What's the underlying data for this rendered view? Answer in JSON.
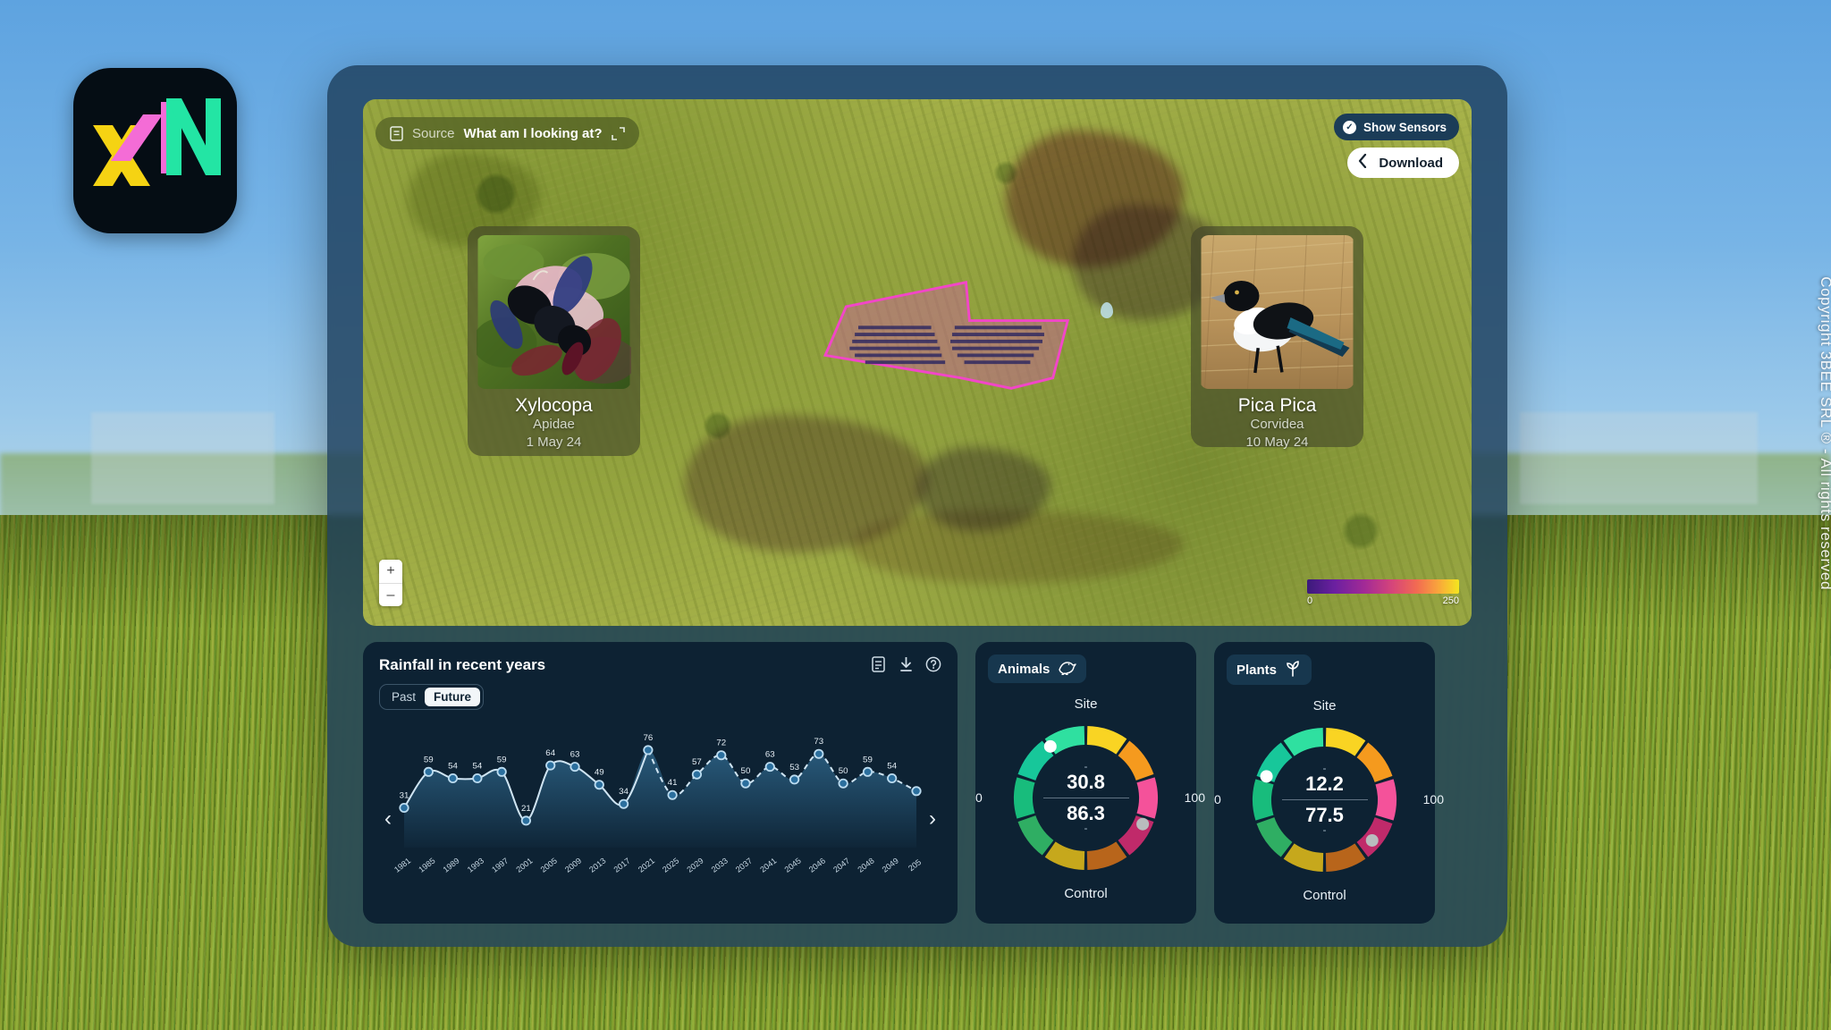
{
  "brand": {
    "logo_name": "xn-logo",
    "logo_colors": {
      "x": "#F5D313",
      "slash": "#F46CD6",
      "n": "#23E5A4",
      "bg": "#050d14"
    }
  },
  "copyright": "Copyright 3BEE SRL ® - All rights reserved",
  "map": {
    "source": {
      "icon": "document-icon",
      "label": "Source",
      "question": "What am I looking at?",
      "expand_icon": "expand-icon"
    },
    "actions": {
      "show_sensors": {
        "label": "Show Sensors",
        "icon": "check-circle-icon"
      },
      "download": {
        "label": "Download",
        "icon": "chevron-left-icon"
      }
    },
    "zoom": {
      "in_label": "+",
      "out_label": "–"
    },
    "legend": {
      "min": "0",
      "max": "250",
      "colors": [
        "#3b1a7a",
        "#a32a96",
        "#f26a52",
        "#f4e61f"
      ]
    },
    "parcel_color": "#F246C8",
    "species": [
      {
        "photo": "carpenter-bee-on-flower",
        "name": "Xylocopa",
        "family": "Apidae",
        "date": "1 May 24"
      },
      {
        "photo": "magpie-on-dry-grass",
        "name": "Pica Pica",
        "family": "Corvidea",
        "date": "10 May 24"
      }
    ]
  },
  "chart_panel": {
    "title": "Rainfall in recent years",
    "tools": [
      {
        "name": "notes-icon",
        "glyph": "note"
      },
      {
        "name": "download-icon",
        "glyph": "download"
      },
      {
        "name": "help-icon",
        "glyph": "help"
      }
    ],
    "segments": [
      {
        "label": "Past",
        "active": false
      },
      {
        "label": "Future",
        "active": true
      }
    ],
    "prev_label": "‹",
    "next_label": "›"
  },
  "chart_data": {
    "type": "line",
    "title": "Rainfall in recent years",
    "xlabel": "",
    "ylabel": "",
    "ylim": [
      0,
      85
    ],
    "grid": false,
    "legend": "none",
    "accent_color": "#4a9fd4",
    "categories": [
      "1981",
      "1985",
      "1989",
      "1993",
      "1997",
      "2001",
      "2005",
      "2009",
      "2013",
      "2017",
      "2021",
      "2025",
      "2029",
      "2033",
      "2037",
      "2041",
      "2045",
      "2046",
      "2047",
      "2048",
      "2049",
      "205"
    ],
    "x_tick_last_clipped": "205",
    "series": [
      {
        "name": "Rainfall",
        "values": [
          31,
          59,
          54,
          54,
          59,
          21,
          64,
          63,
          49,
          34,
          76,
          41,
          57,
          72,
          50,
          63,
          53,
          73,
          50,
          59,
          54,
          44
        ],
        "solid_until_index": 10,
        "style_past": "solid",
        "style_future": "dashed"
      }
    ],
    "point_labels": [
      "31",
      "59",
      "54",
      "54",
      "59",
      "21",
      "64",
      "63",
      "49",
      "34",
      "76",
      "41",
      "57",
      "72",
      "50",
      "63",
      "53",
      "73",
      "50",
      "59",
      "54",
      ""
    ]
  },
  "gauges": [
    {
      "tag": "Animals",
      "icon": "bird-icon",
      "top_label": "Site",
      "bottom_label": "Control",
      "scale_min": "0",
      "scale_max": "100",
      "site_value": "30.8",
      "control_value": "86.3",
      "site_dash": "-",
      "control_dash": "-",
      "site_marker_fraction": 0.308,
      "control_marker_fraction": 0.863
    },
    {
      "tag": "Plants",
      "icon": "sprout-icon",
      "top_label": "Site",
      "bottom_label": "Control",
      "scale_min": "0",
      "scale_max": "100",
      "site_value": "12.2",
      "control_value": "77.5",
      "site_dash": "-",
      "control_dash": "-",
      "site_marker_fraction": 0.122,
      "control_marker_fraction": 0.775
    }
  ],
  "gauge_palette": [
    "#F9D423",
    "#F59A1E",
    "#F4529A",
    "#C02A6A",
    "#B8651B",
    "#C6A81C",
    "#2FAE63",
    "#18BC7C",
    "#17C79A",
    "#2FE0A0"
  ]
}
